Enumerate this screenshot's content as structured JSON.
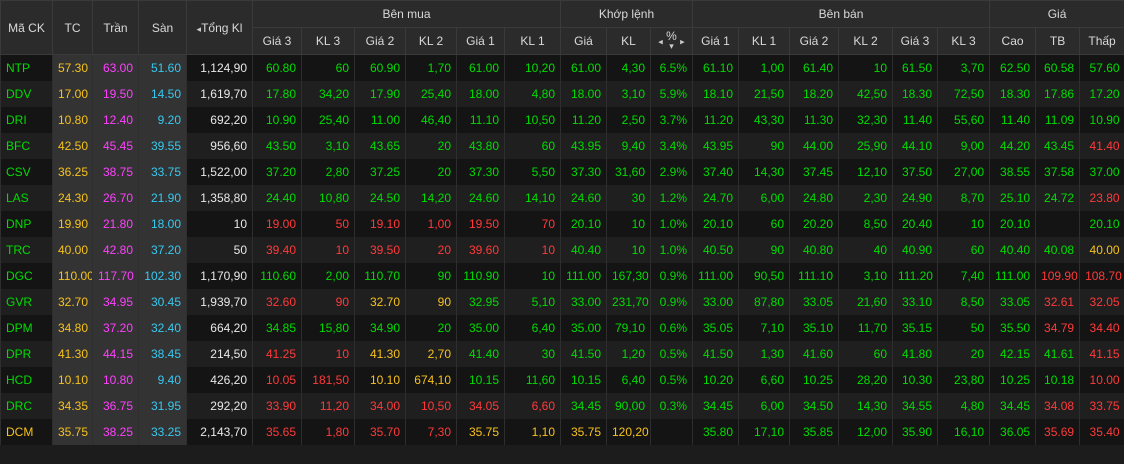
{
  "headers": {
    "symbol": "Mã CK",
    "ref": "TC",
    "ceil": "Trần",
    "floor": "Sàn",
    "total": "Tổng Kl",
    "total_arrow": "◂",
    "buy_group": "Bên mua",
    "match_group": "Khớp lệnh",
    "sell_group": "Bên bán",
    "price_group": "Giá",
    "buy_cols": [
      "Giá 3",
      "KL 3",
      "Giá 2",
      "KL 2",
      "Giá 1",
      "KL 1"
    ],
    "match_cols": [
      "Giá",
      "KL",
      "%"
    ],
    "pct_arrows": "◂",
    "pct_arrows_right": "▸",
    "pct_sort": "▾",
    "sell_cols": [
      "Giá 1",
      "KL 1",
      "Giá 2",
      "KL 2",
      "Giá 3",
      "KL 3"
    ],
    "price_cols": [
      "Cao",
      "TB",
      "Thấp"
    ]
  },
  "colors": {
    "up": "#00dc00",
    "down": "#ff3a3a",
    "ceiling": "#ff40ff",
    "floor": "#36c9f1",
    "reference": "#f7c21c",
    "neutral": "#e8e8e8"
  },
  "rows": [
    {
      "sym": [
        "NTP",
        "up"
      ],
      "ref": "57.30",
      "ceil": "63.00",
      "floor": "51.60",
      "total": "1,124,90",
      "b3p": [
        "60.80",
        "up"
      ],
      "b3v": [
        "60",
        "up"
      ],
      "b2p": [
        "60.90",
        "up"
      ],
      "b2v": [
        "1,70",
        "up"
      ],
      "b1p": [
        "61.00",
        "up"
      ],
      "b1v": [
        "10,20",
        "up"
      ],
      "mp": [
        "61.00",
        "up"
      ],
      "mv": [
        "4,30",
        "up"
      ],
      "pct": [
        "6.5%",
        "up"
      ],
      "s1p": [
        "61.10",
        "up"
      ],
      "s1v": [
        "1,00",
        "up"
      ],
      "s2p": [
        "61.40",
        "up"
      ],
      "s2v": [
        "10",
        "up"
      ],
      "s3p": [
        "61.50",
        "up"
      ],
      "s3v": [
        "3,70",
        "up"
      ],
      "hi": [
        "62.50",
        "up"
      ],
      "avg": [
        "60.58",
        "up"
      ],
      "lo": [
        "57.60",
        "up"
      ]
    },
    {
      "sym": [
        "DDV",
        "up"
      ],
      "ref": "17.00",
      "ceil": "19.50",
      "floor": "14.50",
      "total": "1,619,70",
      "b3p": [
        "17.80",
        "up"
      ],
      "b3v": [
        "34,20",
        "up"
      ],
      "b2p": [
        "17.90",
        "up"
      ],
      "b2v": [
        "25,40",
        "up"
      ],
      "b1p": [
        "18.00",
        "up"
      ],
      "b1v": [
        "4,80",
        "up"
      ],
      "mp": [
        "18.00",
        "up"
      ],
      "mv": [
        "3,10",
        "up"
      ],
      "pct": [
        "5.9%",
        "up"
      ],
      "s1p": [
        "18.10",
        "up"
      ],
      "s1v": [
        "21,50",
        "up"
      ],
      "s2p": [
        "18.20",
        "up"
      ],
      "s2v": [
        "42,50",
        "up"
      ],
      "s3p": [
        "18.30",
        "up"
      ],
      "s3v": [
        "72,50",
        "up"
      ],
      "hi": [
        "18.30",
        "up"
      ],
      "avg": [
        "17.86",
        "up"
      ],
      "lo": [
        "17.20",
        "up"
      ]
    },
    {
      "sym": [
        "DRI",
        "up"
      ],
      "ref": "10.80",
      "ceil": "12.40",
      "floor": "9.20",
      "total": "692,20",
      "b3p": [
        "10.90",
        "up"
      ],
      "b3v": [
        "25,40",
        "up"
      ],
      "b2p": [
        "11.00",
        "up"
      ],
      "b2v": [
        "46,40",
        "up"
      ],
      "b1p": [
        "11.10",
        "up"
      ],
      "b1v": [
        "10,50",
        "up"
      ],
      "mp": [
        "11.20",
        "up"
      ],
      "mv": [
        "2,50",
        "up"
      ],
      "pct": [
        "3.7%",
        "up"
      ],
      "s1p": [
        "11.20",
        "up"
      ],
      "s1v": [
        "43,30",
        "up"
      ],
      "s2p": [
        "11.30",
        "up"
      ],
      "s2v": [
        "32,30",
        "up"
      ],
      "s3p": [
        "11.40",
        "up"
      ],
      "s3v": [
        "55,60",
        "up"
      ],
      "hi": [
        "11.40",
        "up"
      ],
      "avg": [
        "11.09",
        "up"
      ],
      "lo": [
        "10.90",
        "up"
      ]
    },
    {
      "sym": [
        "BFC",
        "up"
      ],
      "ref": "42.50",
      "ceil": "45.45",
      "floor": "39.55",
      "total": "956,60",
      "b3p": [
        "43.50",
        "up"
      ],
      "b3v": [
        "3,10",
        "up"
      ],
      "b2p": [
        "43.65",
        "up"
      ],
      "b2v": [
        "20",
        "up"
      ],
      "b1p": [
        "43.80",
        "up"
      ],
      "b1v": [
        "60",
        "up"
      ],
      "mp": [
        "43.95",
        "up"
      ],
      "mv": [
        "9,40",
        "up"
      ],
      "pct": [
        "3.4%",
        "up"
      ],
      "s1p": [
        "43.95",
        "up"
      ],
      "s1v": [
        "90",
        "up"
      ],
      "s2p": [
        "44.00",
        "up"
      ],
      "s2v": [
        "25,90",
        "up"
      ],
      "s3p": [
        "44.10",
        "up"
      ],
      "s3v": [
        "9,00",
        "up"
      ],
      "hi": [
        "44.20",
        "up"
      ],
      "avg": [
        "43.45",
        "up"
      ],
      "lo": [
        "41.40",
        "dn"
      ]
    },
    {
      "sym": [
        "CSV",
        "up"
      ],
      "ref": "36.25",
      "ceil": "38.75",
      "floor": "33.75",
      "total": "1,522,00",
      "b3p": [
        "37.20",
        "up"
      ],
      "b3v": [
        "2,80",
        "up"
      ],
      "b2p": [
        "37.25",
        "up"
      ],
      "b2v": [
        "20",
        "up"
      ],
      "b1p": [
        "37.30",
        "up"
      ],
      "b1v": [
        "5,50",
        "up"
      ],
      "mp": [
        "37.30",
        "up"
      ],
      "mv": [
        "31,60",
        "up"
      ],
      "pct": [
        "2.9%",
        "up"
      ],
      "s1p": [
        "37.40",
        "up"
      ],
      "s1v": [
        "14,30",
        "up"
      ],
      "s2p": [
        "37.45",
        "up"
      ],
      "s2v": [
        "12,10",
        "up"
      ],
      "s3p": [
        "37.50",
        "up"
      ],
      "s3v": [
        "27,00",
        "up"
      ],
      "hi": [
        "38.55",
        "up"
      ],
      "avg": [
        "37.58",
        "up"
      ],
      "lo": [
        "37.00",
        "up"
      ]
    },
    {
      "sym": [
        "LAS",
        "up"
      ],
      "ref": "24.30",
      "ceil": "26.70",
      "floor": "21.90",
      "total": "1,358,80",
      "b3p": [
        "24.40",
        "up"
      ],
      "b3v": [
        "10,80",
        "up"
      ],
      "b2p": [
        "24.50",
        "up"
      ],
      "b2v": [
        "14,20",
        "up"
      ],
      "b1p": [
        "24.60",
        "up"
      ],
      "b1v": [
        "14,10",
        "up"
      ],
      "mp": [
        "24.60",
        "up"
      ],
      "mv": [
        "30",
        "up"
      ],
      "pct": [
        "1.2%",
        "up"
      ],
      "s1p": [
        "24.70",
        "up"
      ],
      "s1v": [
        "6,00",
        "up"
      ],
      "s2p": [
        "24.80",
        "up"
      ],
      "s2v": [
        "2,30",
        "up"
      ],
      "s3p": [
        "24.90",
        "up"
      ],
      "s3v": [
        "8,70",
        "up"
      ],
      "hi": [
        "25.10",
        "up"
      ],
      "avg": [
        "24.72",
        "up"
      ],
      "lo": [
        "23.80",
        "dn"
      ]
    },
    {
      "sym": [
        "DNP",
        "up"
      ],
      "ref": "19.90",
      "ceil": "21.80",
      "floor": "18.00",
      "total": "10",
      "b3p": [
        "19.00",
        "dn"
      ],
      "b3v": [
        "50",
        "dn"
      ],
      "b2p": [
        "19.10",
        "dn"
      ],
      "b2v": [
        "1,00",
        "dn"
      ],
      "b1p": [
        "19.50",
        "dn"
      ],
      "b1v": [
        "70",
        "dn"
      ],
      "mp": [
        "20.10",
        "up"
      ],
      "mv": [
        "10",
        "up"
      ],
      "pct": [
        "1.0%",
        "up"
      ],
      "s1p": [
        "20.10",
        "up"
      ],
      "s1v": [
        "60",
        "up"
      ],
      "s2p": [
        "20.20",
        "up"
      ],
      "s2v": [
        "8,50",
        "up"
      ],
      "s3p": [
        "20.40",
        "up"
      ],
      "s3v": [
        "10",
        "up"
      ],
      "hi": [
        "20.10",
        "up"
      ],
      "avg": [
        "",
        ""
      ],
      "lo": [
        "20.10",
        "up"
      ]
    },
    {
      "sym": [
        "TRC",
        "up"
      ],
      "ref": "40.00",
      "ceil": "42.80",
      "floor": "37.20",
      "total": "50",
      "b3p": [
        "39.40",
        "dn"
      ],
      "b3v": [
        "10",
        "dn"
      ],
      "b2p": [
        "39.50",
        "dn"
      ],
      "b2v": [
        "20",
        "dn"
      ],
      "b1p": [
        "39.60",
        "dn"
      ],
      "b1v": [
        "10",
        "dn"
      ],
      "mp": [
        "40.40",
        "up"
      ],
      "mv": [
        "10",
        "up"
      ],
      "pct": [
        "1.0%",
        "up"
      ],
      "s1p": [
        "40.50",
        "up"
      ],
      "s1v": [
        "90",
        "up"
      ],
      "s2p": [
        "40.80",
        "up"
      ],
      "s2v": [
        "40",
        "up"
      ],
      "s3p": [
        "40.90",
        "up"
      ],
      "s3v": [
        "60",
        "up"
      ],
      "hi": [
        "40.40",
        "up"
      ],
      "avg": [
        "40.08",
        "up"
      ],
      "lo": [
        "40.00",
        "rf"
      ]
    },
    {
      "sym": [
        "DGC",
        "up"
      ],
      "ref": "110.00",
      "ceil": "117.70",
      "floor": "102.30",
      "total": "1,170,90",
      "b3p": [
        "110.60",
        "up"
      ],
      "b3v": [
        "2,00",
        "up"
      ],
      "b2p": [
        "110.70",
        "up"
      ],
      "b2v": [
        "90",
        "up"
      ],
      "b1p": [
        "110.90",
        "up"
      ],
      "b1v": [
        "10",
        "up"
      ],
      "mp": [
        "111.00",
        "up"
      ],
      "mv": [
        "167,30",
        "up"
      ],
      "pct": [
        "0.9%",
        "up"
      ],
      "s1p": [
        "111.00",
        "up"
      ],
      "s1v": [
        "90,50",
        "up"
      ],
      "s2p": [
        "111.10",
        "up"
      ],
      "s2v": [
        "3,10",
        "up"
      ],
      "s3p": [
        "111.20",
        "up"
      ],
      "s3v": [
        "7,40",
        "up"
      ],
      "hi": [
        "111.00",
        "up"
      ],
      "avg": [
        "109.90",
        "dn"
      ],
      "lo": [
        "108.70",
        "dn"
      ]
    },
    {
      "sym": [
        "GVR",
        "up"
      ],
      "ref": "32.70",
      "ceil": "34.95",
      "floor": "30.45",
      "total": "1,939,70",
      "b3p": [
        "32.60",
        "dn"
      ],
      "b3v": [
        "90",
        "dn"
      ],
      "b2p": [
        "32.70",
        "rf"
      ],
      "b2v": [
        "90",
        "rf"
      ],
      "b1p": [
        "32.95",
        "up"
      ],
      "b1v": [
        "5,10",
        "up"
      ],
      "mp": [
        "33.00",
        "up"
      ],
      "mv": [
        "231,70",
        "up"
      ],
      "pct": [
        "0.9%",
        "up"
      ],
      "s1p": [
        "33.00",
        "up"
      ],
      "s1v": [
        "87,80",
        "up"
      ],
      "s2p": [
        "33.05",
        "up"
      ],
      "s2v": [
        "21,60",
        "up"
      ],
      "s3p": [
        "33.10",
        "up"
      ],
      "s3v": [
        "8,50",
        "up"
      ],
      "hi": [
        "33.05",
        "up"
      ],
      "avg": [
        "32.61",
        "dn"
      ],
      "lo": [
        "32.05",
        "dn"
      ]
    },
    {
      "sym": [
        "DPM",
        "up"
      ],
      "ref": "34.80",
      "ceil": "37.20",
      "floor": "32.40",
      "total": "664,20",
      "b3p": [
        "34.85",
        "up"
      ],
      "b3v": [
        "15,80",
        "up"
      ],
      "b2p": [
        "34.90",
        "up"
      ],
      "b2v": [
        "20",
        "up"
      ],
      "b1p": [
        "35.00",
        "up"
      ],
      "b1v": [
        "6,40",
        "up"
      ],
      "mp": [
        "35.00",
        "up"
      ],
      "mv": [
        "79,10",
        "up"
      ],
      "pct": [
        "0.6%",
        "up"
      ],
      "s1p": [
        "35.05",
        "up"
      ],
      "s1v": [
        "7,10",
        "up"
      ],
      "s2p": [
        "35.10",
        "up"
      ],
      "s2v": [
        "11,70",
        "up"
      ],
      "s3p": [
        "35.15",
        "up"
      ],
      "s3v": [
        "50",
        "up"
      ],
      "hi": [
        "35.50",
        "up"
      ],
      "avg": [
        "34.79",
        "dn"
      ],
      "lo": [
        "34.40",
        "dn"
      ]
    },
    {
      "sym": [
        "DPR",
        "up"
      ],
      "ref": "41.30",
      "ceil": "44.15",
      "floor": "38.45",
      "total": "214,50",
      "b3p": [
        "41.25",
        "dn"
      ],
      "b3v": [
        "10",
        "dn"
      ],
      "b2p": [
        "41.30",
        "rf"
      ],
      "b2v": [
        "2,70",
        "rf"
      ],
      "b1p": [
        "41.40",
        "up"
      ],
      "b1v": [
        "30",
        "up"
      ],
      "mp": [
        "41.50",
        "up"
      ],
      "mv": [
        "1,20",
        "up"
      ],
      "pct": [
        "0.5%",
        "up"
      ],
      "s1p": [
        "41.50",
        "up"
      ],
      "s1v": [
        "1,30",
        "up"
      ],
      "s2p": [
        "41.60",
        "up"
      ],
      "s2v": [
        "60",
        "up"
      ],
      "s3p": [
        "41.80",
        "up"
      ],
      "s3v": [
        "20",
        "up"
      ],
      "hi": [
        "42.15",
        "up"
      ],
      "avg": [
        "41.61",
        "up"
      ],
      "lo": [
        "41.15",
        "dn"
      ]
    },
    {
      "sym": [
        "HCD",
        "up"
      ],
      "ref": "10.10",
      "ceil": "10.80",
      "floor": "9.40",
      "total": "426,20",
      "b3p": [
        "10.05",
        "dn"
      ],
      "b3v": [
        "181,50",
        "dn"
      ],
      "b2p": [
        "10.10",
        "rf"
      ],
      "b2v": [
        "674,10",
        "rf"
      ],
      "b1p": [
        "10.15",
        "up"
      ],
      "b1v": [
        "11,60",
        "up"
      ],
      "mp": [
        "10.15",
        "up"
      ],
      "mv": [
        "6,40",
        "up"
      ],
      "pct": [
        "0.5%",
        "up"
      ],
      "s1p": [
        "10.20",
        "up"
      ],
      "s1v": [
        "6,60",
        "up"
      ],
      "s2p": [
        "10.25",
        "up"
      ],
      "s2v": [
        "28,20",
        "up"
      ],
      "s3p": [
        "10.30",
        "up"
      ],
      "s3v": [
        "23,80",
        "up"
      ],
      "hi": [
        "10.25",
        "up"
      ],
      "avg": [
        "10.18",
        "up"
      ],
      "lo": [
        "10.00",
        "dn"
      ]
    },
    {
      "sym": [
        "DRC",
        "up"
      ],
      "ref": "34.35",
      "ceil": "36.75",
      "floor": "31.95",
      "total": "292,20",
      "b3p": [
        "33.90",
        "dn"
      ],
      "b3v": [
        "11,20",
        "dn"
      ],
      "b2p": [
        "34.00",
        "dn"
      ],
      "b2v": [
        "10,50",
        "dn"
      ],
      "b1p": [
        "34.05",
        "dn"
      ],
      "b1v": [
        "6,60",
        "dn"
      ],
      "mp": [
        "34.45",
        "up"
      ],
      "mv": [
        "90,00",
        "up"
      ],
      "pct": [
        "0.3%",
        "up"
      ],
      "s1p": [
        "34.45",
        "up"
      ],
      "s1v": [
        "6,00",
        "up"
      ],
      "s2p": [
        "34.50",
        "up"
      ],
      "s2v": [
        "14,30",
        "up"
      ],
      "s3p": [
        "34.55",
        "up"
      ],
      "s3v": [
        "4,80",
        "up"
      ],
      "hi": [
        "34.45",
        "up"
      ],
      "avg": [
        "34.08",
        "dn"
      ],
      "lo": [
        "33.75",
        "dn"
      ]
    },
    {
      "sym": [
        "DCM",
        "rf"
      ],
      "ref": "35.75",
      "ceil": "38.25",
      "floor": "33.25",
      "total": "2,143,70",
      "b3p": [
        "35.65",
        "dn"
      ],
      "b3v": [
        "1,80",
        "dn"
      ],
      "b2p": [
        "35.70",
        "dn"
      ],
      "b2v": [
        "7,30",
        "dn"
      ],
      "b1p": [
        "35.75",
        "rf"
      ],
      "b1v": [
        "1,10",
        "rf"
      ],
      "mp": [
        "35.75",
        "rf"
      ],
      "mv": [
        "120,20",
        "rf"
      ],
      "pct": [
        "",
        ""
      ],
      "s1p": [
        "35.80",
        "up"
      ],
      "s1v": [
        "17,10",
        "up"
      ],
      "s2p": [
        "35.85",
        "up"
      ],
      "s2v": [
        "12,00",
        "up"
      ],
      "s3p": [
        "35.90",
        "up"
      ],
      "s3v": [
        "16,10",
        "up"
      ],
      "hi": [
        "36.05",
        "up"
      ],
      "avg": [
        "35.69",
        "dn"
      ],
      "lo": [
        "35.40",
        "dn"
      ]
    }
  ]
}
